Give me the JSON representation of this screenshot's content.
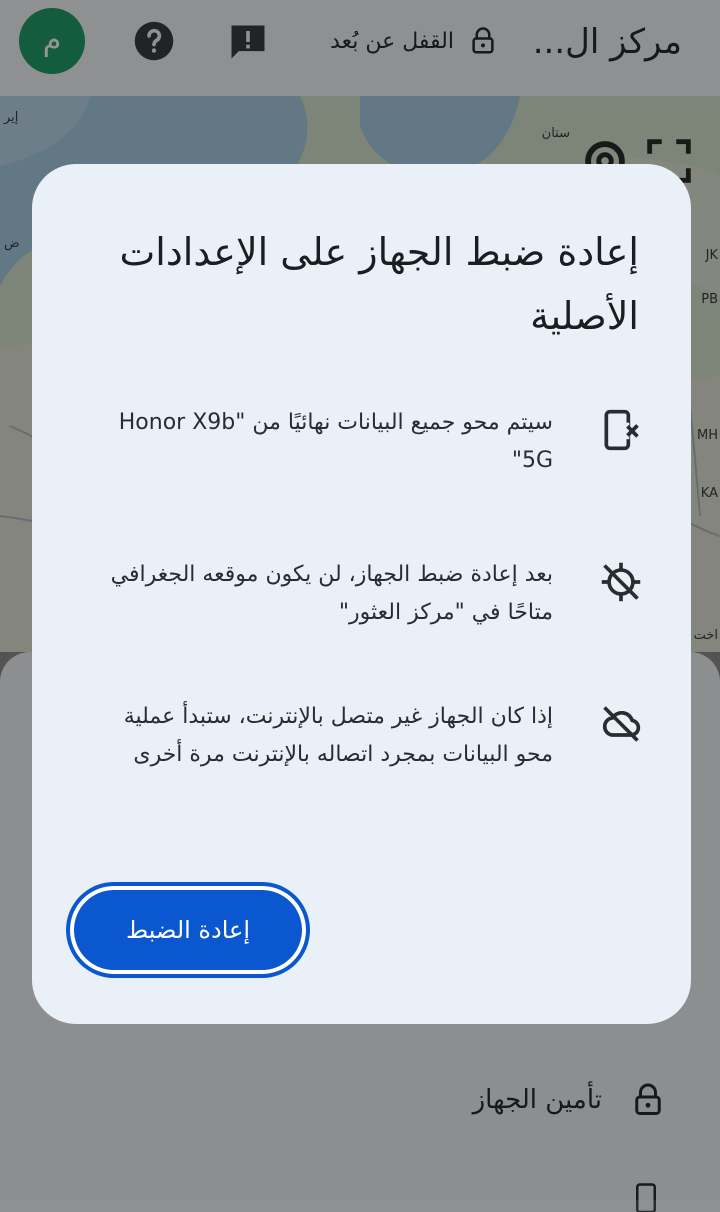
{
  "header": {
    "title": "مركز ال...",
    "remote_lock_label": "القفل عن بُعد",
    "avatar_initial": "م",
    "icons": [
      "lock-icon",
      "feedback-icon",
      "help-icon"
    ]
  },
  "map": {
    "labels": [
      "ستان",
      "إير",
      "ض",
      "JK",
      "PB",
      "MH",
      "KA",
      "اخت"
    ]
  },
  "dialog": {
    "title": "إعادة ضبط الجهاز على الإعدادات الأصلية",
    "items": [
      {
        "icon": "phone-erase-icon",
        "text": "سيتم محو جميع البيانات نهائيًا من \"Honor X9b 5G\""
      },
      {
        "icon": "location-off-icon",
        "text": "بعد إعادة ضبط الجهاز، لن يكون موقعه الجغرافي متاحًا في \"مركز العثور\""
      },
      {
        "icon": "cloud-off-icon",
        "text": "إذا كان الجهاز غير متصل بالإنترنت، ستبدأ عملية محو البيانات بمجرد اتصاله بالإنترنت مرة أخرى"
      }
    ],
    "reset_button_label": "إعادة الضبط"
  },
  "sheet": {
    "secure_device_label": "تأمين الجهاز"
  },
  "colors": {
    "primary": "#0b57d0",
    "avatar": "#22a06b",
    "dialog_bg": "#e9f0f8"
  }
}
